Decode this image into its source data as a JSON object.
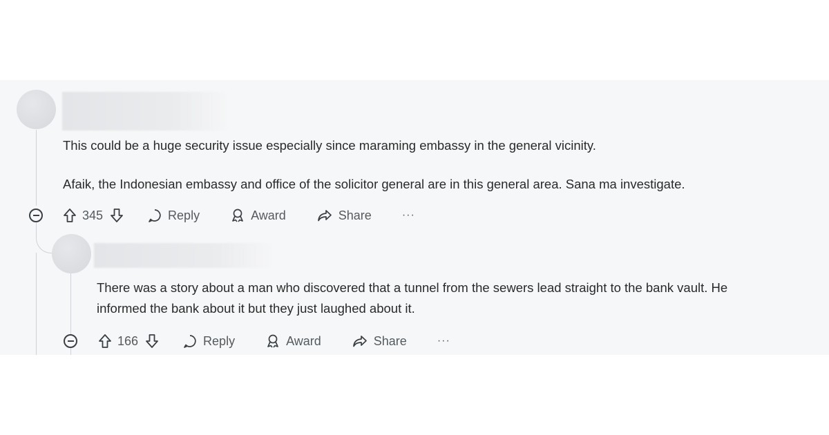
{
  "comments": [
    {
      "paragraphs": [
        "This could be a huge security issue especially since maraming embassy in the general vicinity.",
        "Afaik, the Indonesian embassy and office of the solicitor general are in this general area. Sana ma investigate."
      ],
      "score": "345",
      "reply_label": "Reply",
      "award_label": "Award",
      "share_label": "Share",
      "more_label": "···"
    },
    {
      "paragraphs": [
        "There was a story about a man who discovered that a tunnel from the sewers lead straight to the bank vault. He informed the bank about it but they just laughed about it."
      ],
      "score": "166",
      "reply_label": "Reply",
      "award_label": "Award",
      "share_label": "Share",
      "more_label": "···"
    }
  ],
  "icons": [
    "upvote-icon",
    "downvote-icon",
    "comment-bubble-icon",
    "award-icon",
    "share-icon",
    "collapse-icon"
  ]
}
